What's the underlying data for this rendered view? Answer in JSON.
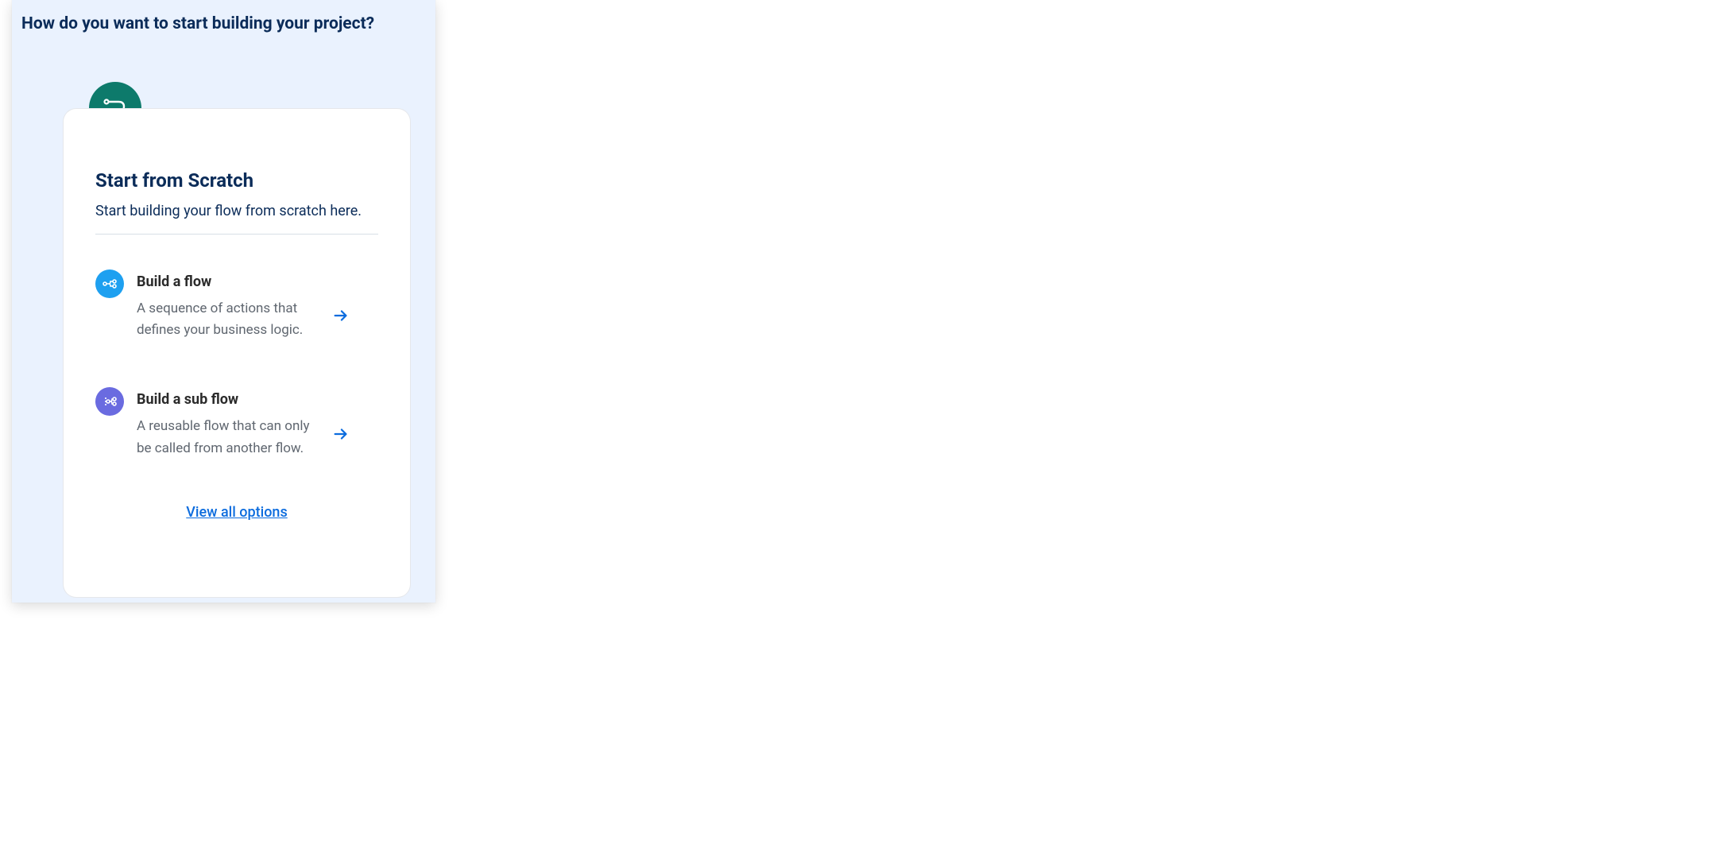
{
  "panel": {
    "title": "How do you want to start building your project?"
  },
  "card": {
    "title": "Start from Scratch",
    "subtitle": "Start building your flow from scratch here.",
    "options": [
      {
        "title": "Build a flow",
        "description": "A sequence of actions that defines your business logic."
      },
      {
        "title": "Build a sub flow",
        "description": "A reusable flow that can only be called from another flow."
      }
    ],
    "view_all_label": "View all options"
  }
}
